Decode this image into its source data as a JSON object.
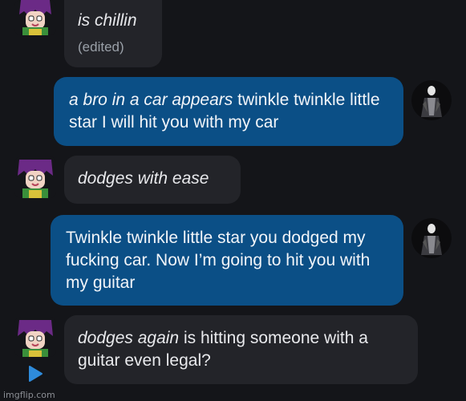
{
  "messages": [
    {
      "sender": "received",
      "action": "is chillin",
      "text": "",
      "edited_label": "(edited)"
    },
    {
      "sender": "sent",
      "action": "a bro in a car appears",
      "text": " twinkle twinkle little star I will hit you with my car"
    },
    {
      "sender": "received",
      "action": "dodges with ease",
      "text": ""
    },
    {
      "sender": "sent",
      "action": "",
      "text": "Twinkle twinkle little star you dodged my fucking car. Now I’m going to hit you with my guitar"
    },
    {
      "sender": "received",
      "action": "dodges again",
      "text": " is hitting someone with a guitar even legal?"
    }
  ],
  "watermark": "imgflip.com",
  "colors": {
    "background": "#141519",
    "received_bubble": "#232429",
    "sent_bubble": "#0b4f86"
  },
  "icons": {
    "received_avatar": "purple-haired-character-avatar",
    "sent_avatar": "dark-cloaked-figure-avatar",
    "play": "play-triangle-icon"
  }
}
